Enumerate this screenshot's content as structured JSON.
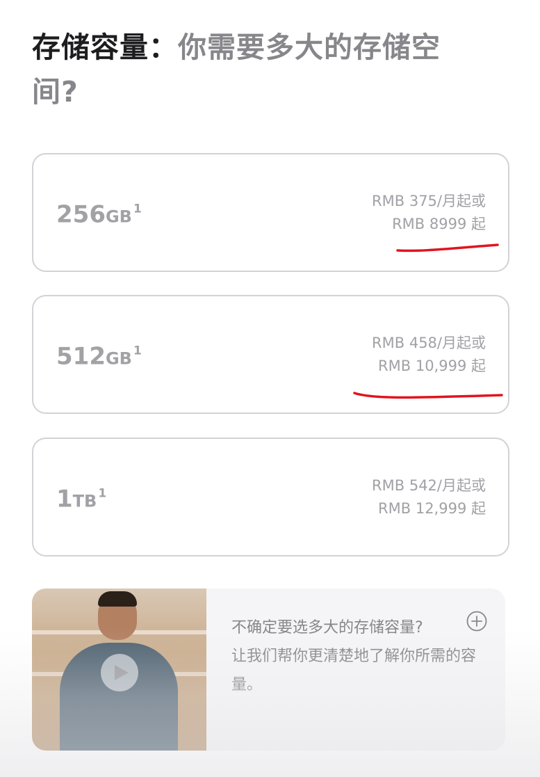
{
  "heading": {
    "strong": "存储容量：",
    "soft": "你需要多大的存储空间?"
  },
  "options": [
    {
      "number": "256",
      "unit": "GB",
      "footnote": "1",
      "monthly": "RMB 375/月起或",
      "total": "RMB 8999 起"
    },
    {
      "number": "512",
      "unit": "GB",
      "footnote": "1",
      "monthly": "RMB 458/月起或",
      "total": "RMB 10,999 起"
    },
    {
      "number": "1",
      "unit": "TB",
      "footnote": "1",
      "monthly": "RMB 542/月起或",
      "total": "RMB 12,999 起"
    }
  ],
  "promo": {
    "title": "不确定要选多大的存储容量?",
    "body": "让我们帮你更清楚地了解你所需的容量。",
    "video_icon": "play-icon",
    "expand_icon": "plus-circle-icon"
  },
  "annotation_color": "#e0141e",
  "colors": {
    "text_primary": "#1d1d1f",
    "text_secondary": "#86868b",
    "border": "#d2d2d7"
  }
}
